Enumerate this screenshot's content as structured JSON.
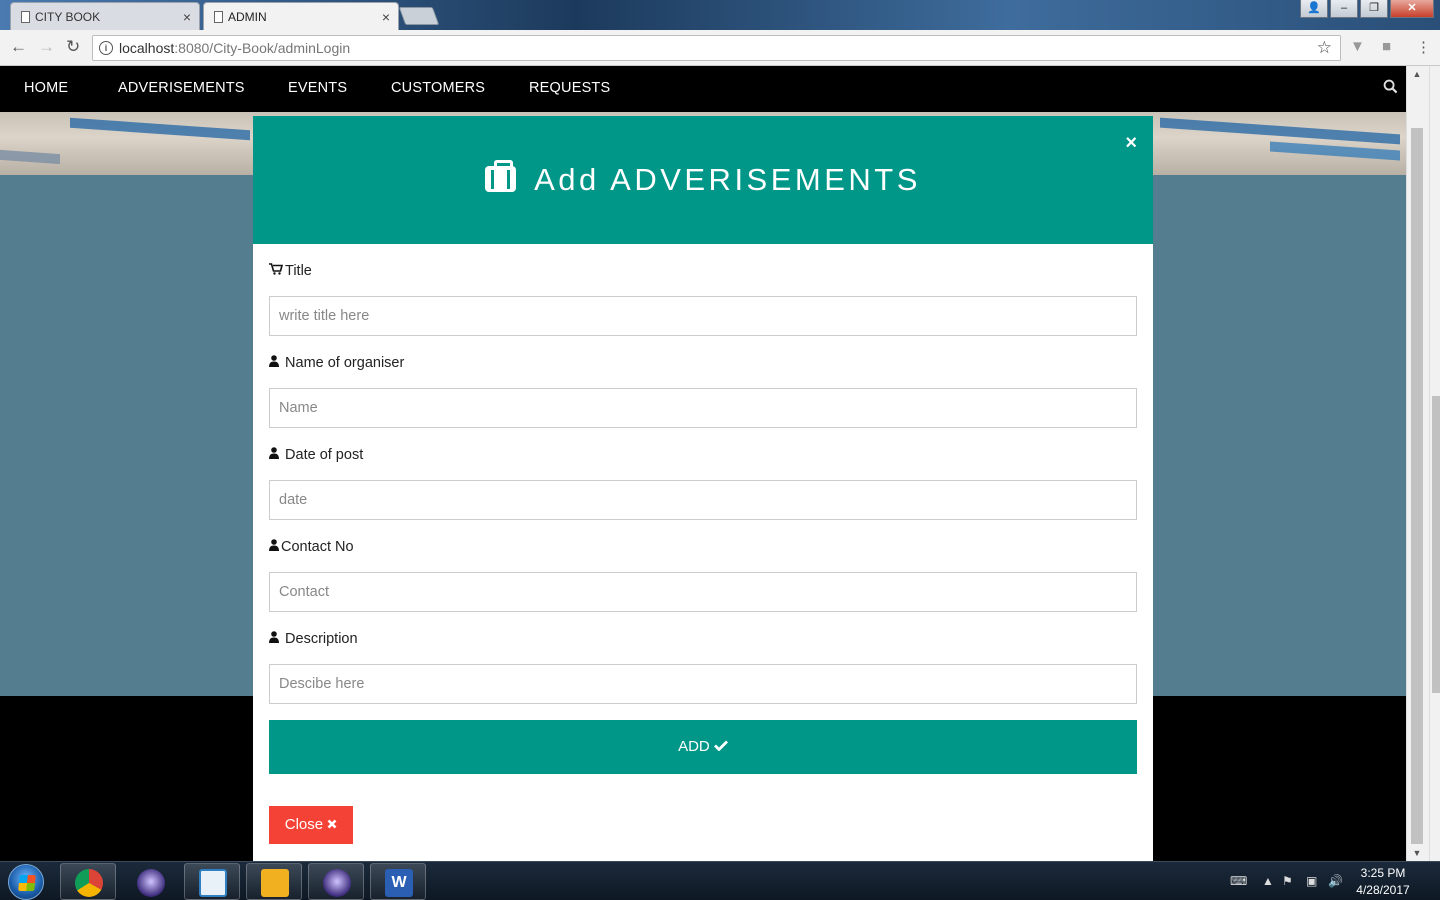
{
  "browser": {
    "tabs": [
      {
        "label": "CITY BOOK",
        "active": false
      },
      {
        "label": "ADMIN",
        "active": true
      }
    ],
    "url_host": "localhost",
    "url_path": ":8080/City-Book/adminLogin"
  },
  "nav": {
    "items": [
      "HOME",
      "ADVERISEMENTS",
      "EVENTS",
      "CUSTOMERS",
      "REQUESTS"
    ],
    "search_icon": "search-icon"
  },
  "modal": {
    "title": "Add ADVERISEMENTS",
    "close_symbol": "×",
    "fields": [
      {
        "label": "Title",
        "icon": "shopping-cart-icon",
        "placeholder": "write title here"
      },
      {
        "label": "Name of organiser",
        "icon": "user-icon",
        "placeholder": "Name"
      },
      {
        "label": "Date of post",
        "icon": "user-icon",
        "placeholder": "date"
      },
      {
        "label": "Contact No",
        "icon": "user-icon",
        "placeholder": "Contact"
      },
      {
        "label": "Description",
        "icon": "user-icon",
        "placeholder": "Descibe here"
      }
    ],
    "add_button": "ADD",
    "close_button": "Close"
  },
  "colors": {
    "accent": "#009688",
    "danger": "#f44336",
    "backdrop": "#547e8f",
    "nav_bg": "#000000"
  },
  "taskbar": {
    "apps": [
      "chrome",
      "eclipse",
      "lync",
      "outlook",
      "eclipse",
      "word"
    ],
    "time": "3:25 PM",
    "date": "4/28/2017"
  }
}
